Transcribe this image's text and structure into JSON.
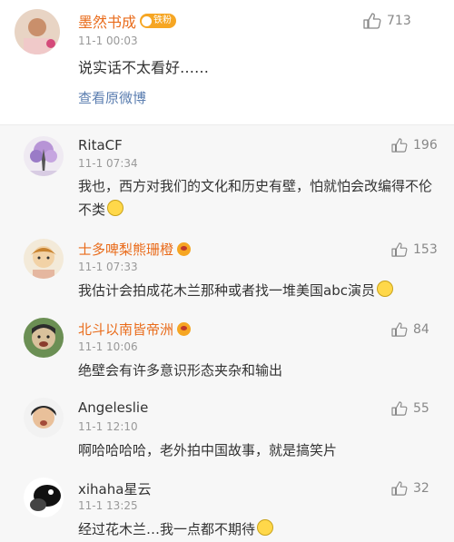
{
  "main_comment": {
    "username": "墨然书成",
    "badge": "铁粉",
    "timestamp": "11-1 00:03",
    "text": "说实话不太看好……",
    "link": "查看原微博",
    "likes": "713"
  },
  "replies": [
    {
      "username": "RitaCF",
      "timestamp": "11-1 07:34",
      "text": "我也，西方对我们的文化和历史有壁，怕就怕会改编得不伦不类",
      "likes": "196"
    },
    {
      "username": "士多啤梨熊珊橙",
      "timestamp": "11-1 07:33",
      "text": "我估计会拍成花木兰那种或者找一堆美国abc演员",
      "likes": "153"
    },
    {
      "username": "北斗以南皆帝洲",
      "timestamp": "11-1 10:06",
      "text": "绝壁会有许多意识形态夹杂和输出",
      "likes": "84"
    },
    {
      "username": "Angeleslie",
      "timestamp": "11-1 12:10",
      "text": "啊哈哈哈哈，老外拍中国故事，就是搞笑片",
      "likes": "55"
    },
    {
      "username": "xihaha星云",
      "timestamp": "11-1 13:25",
      "text": "经过花木兰…我一点都不期待",
      "likes": "32"
    }
  ],
  "colors": {
    "orange_name": "#e96b1a",
    "link_blue": "#5b7eb0",
    "reply_bg": "#f7f7f7",
    "meta_gray": "#999999"
  }
}
